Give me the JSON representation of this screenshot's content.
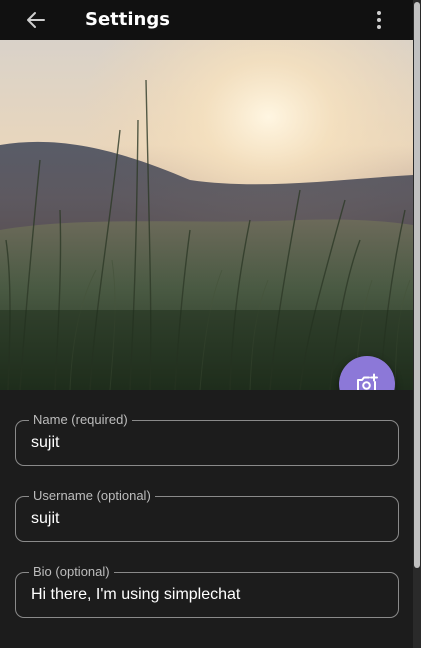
{
  "header": {
    "title": "Settings",
    "back_icon": "arrow-left-icon",
    "menu_icon": "more-vertical-icon"
  },
  "hero": {
    "fab_icon": "camera-add-icon",
    "fab_color": "#8c78d8"
  },
  "form": {
    "fields": [
      {
        "label": "Name (required)",
        "value": "sujit"
      },
      {
        "label": "Username (optional)",
        "value": "sujit"
      },
      {
        "label": "Bio (optional)",
        "value": "Hi there, I'm using simplechat"
      }
    ]
  },
  "colors": {
    "background": "#1c1c1c",
    "header": "#111111",
    "accent": "#8c78d8",
    "field_border": "#8a8a8a"
  }
}
